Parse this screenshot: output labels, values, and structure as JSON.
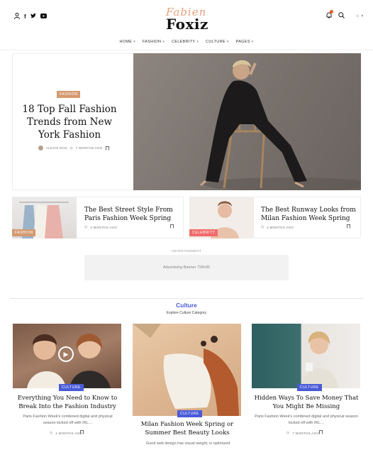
{
  "header": {
    "logo_script": "Fabien",
    "logo": "Foxiz",
    "social_icons": [
      "user-icon",
      "facebook-icon",
      "twitter-icon",
      "youtube-icon"
    ],
    "right_icons": [
      "bell-icon",
      "search-icon",
      "theme-toggle-icon"
    ],
    "accent": "#f05a28"
  },
  "nav": {
    "items": [
      {
        "label": "HOME"
      },
      {
        "label": "FASHION"
      },
      {
        "label": "CELEBRITY"
      },
      {
        "label": "CULTURE"
      },
      {
        "label": "PAGES"
      }
    ]
  },
  "hero": {
    "badge": "FASHION",
    "title": "18 Top Fall Fashion Trends from New York Fashion",
    "author": "ALEXIS RAN",
    "time": "7 MONTHS AGO"
  },
  "cards": [
    {
      "badge": "FASHION",
      "title": "The Best Street Style From Paris Fashion Week Spring",
      "time": "4 MONTHS AGO",
      "badge_color": "#d49a70"
    },
    {
      "badge": "CELEBRITY",
      "title": "The Best Runway Looks from Milan Fashion Week Spring",
      "time": "4 MONTHS AGO",
      "badge_color": "#f06c6c"
    }
  ],
  "ad": {
    "label": "- ADVERTISEMENT -",
    "text": "Advertising Banner 728x90"
  },
  "section": {
    "title": "Culture",
    "subtitle": "Explore Culture Category",
    "color": "#4a5bd8"
  },
  "grid": [
    {
      "badge": "CULTURE",
      "title": "Everything You Need to Know to Break Into the Fashion Industry",
      "excerpt": "Paris Fashion Week's combined digital and physical season kicked off with IRL…",
      "time": "4 MONTHS AGO"
    },
    {
      "badge": "CULTURE",
      "title": "Milan Fashion Week Spring or Summer Best Beauty Looks",
      "excerpt": "Good web design has visual weight, is optimized",
      "time": ""
    },
    {
      "badge": "CULTURE",
      "title": "Hidden Ways To Save Money That You Might Be Missing",
      "excerpt": "Paris Fashion Week's combined digital and physical season kicked off with IRL…",
      "time": "7 MONTHS AGO"
    }
  ]
}
